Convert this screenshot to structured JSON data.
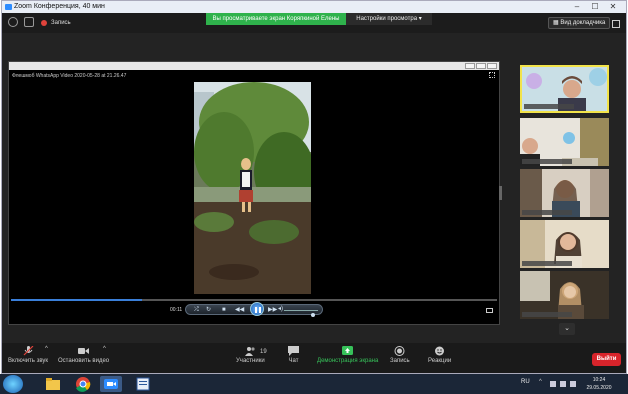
{
  "window": {
    "title": "Zoom Конференция, 40 мин",
    "controls": [
      "–",
      "☐",
      "✕"
    ]
  },
  "topbar": {
    "record_label": "Запись",
    "share_banner": "Вы просматриваете экран Коряпкиной Елены",
    "view_options": "Настройки просмотра ▾",
    "speaker_view": "Вид докладчика",
    "banner_color": "#2fb24c"
  },
  "player": {
    "filename": "Флешмоб WhatsApp Video 2020-05-28 at 21.26.47",
    "time": "00:11",
    "progress_fraction": 0.27,
    "volume_fraction": 0.85
  },
  "gallery": {
    "tile_count": 5,
    "scroll_icon": "chevron-down-icon"
  },
  "toolbar": {
    "mute_label": "Включить звук",
    "video_label": "Остановить видео",
    "participants_label": "Участники",
    "participants_count": "19",
    "chat_label": "Чат",
    "share_label": "Демонстрация экрана",
    "record_label": "Запись",
    "reactions_label": "Реакции",
    "end_label": "Выйти",
    "end_color": "#d8242b",
    "share_color": "#37c25a"
  },
  "taskbar": {
    "lang": "RU",
    "time": "10:24",
    "date": "29.05.2020"
  }
}
